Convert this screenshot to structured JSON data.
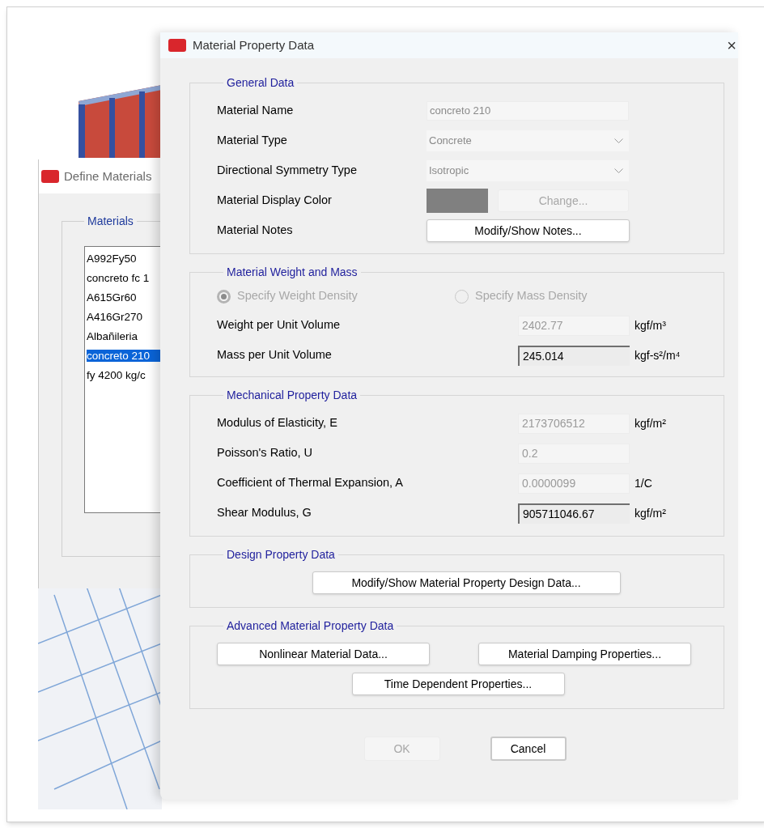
{
  "background_window": {
    "title": "Define Materials",
    "group_label": "Materials",
    "items": [
      {
        "label": "A992Fy50",
        "selected": false
      },
      {
        "label": "concreto fc 1",
        "selected": false
      },
      {
        "label": "A615Gr60",
        "selected": false
      },
      {
        "label": "A416Gr270",
        "selected": false
      },
      {
        "label": "Albañileria",
        "selected": false
      },
      {
        "label": "concreto 210",
        "selected": true
      },
      {
        "label": "fy 4200 kg/c",
        "selected": false
      }
    ]
  },
  "dialog": {
    "title": "Material Property Data",
    "close": "×",
    "general": {
      "heading": "General Data",
      "rows": [
        {
          "kind": "text",
          "label": "Material Name",
          "value": "concreto 210"
        },
        {
          "kind": "dropdown",
          "label": "Material Type",
          "value": "Concrete"
        },
        {
          "kind": "dropdown",
          "label": "Directional Symmetry Type",
          "value": "Isotropic"
        },
        {
          "kind": "color",
          "label": "Material Display Color",
          "color": "#808080",
          "button": "Change...",
          "disabled": true
        },
        {
          "kind": "button",
          "label": "Material Notes",
          "button": "Modify/Show Notes...",
          "disabled": false
        }
      ]
    },
    "weight": {
      "heading": "Material Weight and Mass",
      "options": [
        {
          "label": "Specify Weight Density",
          "selected": true,
          "disabled": true
        },
        {
          "label": "Specify Mass Density",
          "selected": false,
          "disabled": true
        }
      ],
      "rows": [
        {
          "label": "Weight per Unit Volume",
          "value": "2402.77",
          "unit": "kgf/m³",
          "editable": false
        },
        {
          "label": "Mass per Unit Volume",
          "value": "245.014",
          "unit": "kgf-s²/m⁴",
          "editable": true
        }
      ]
    },
    "mechanical": {
      "heading": "Mechanical Property Data",
      "rows": [
        {
          "label": "Modulus of Elasticity,  E",
          "value": "2173706512",
          "unit": "kgf/m²",
          "editable": false
        },
        {
          "label": "Poisson's Ratio,  U",
          "value": "0.2",
          "editable": false
        },
        {
          "label": "Coefficient of Thermal Expansion,  A",
          "value": "0.0000099",
          "unit": "1/C",
          "editable": false
        },
        {
          "label": "Shear Modulus,  G",
          "value": "905711046.67",
          "unit": "kgf/m²",
          "editable": true
        }
      ]
    },
    "design": {
      "heading": "Design Property Data",
      "button": "Modify/Show Material Property Design Data..."
    },
    "advanced": {
      "heading": "Advanced Material Property Data",
      "buttons": [
        "Nonlinear Material Data...",
        "Material Damping Properties...",
        "Time Dependent Properties..."
      ]
    },
    "footer": [
      {
        "label": "OK",
        "disabled": true,
        "default": false
      },
      {
        "label": "Cancel",
        "disabled": false,
        "default": true
      }
    ]
  }
}
